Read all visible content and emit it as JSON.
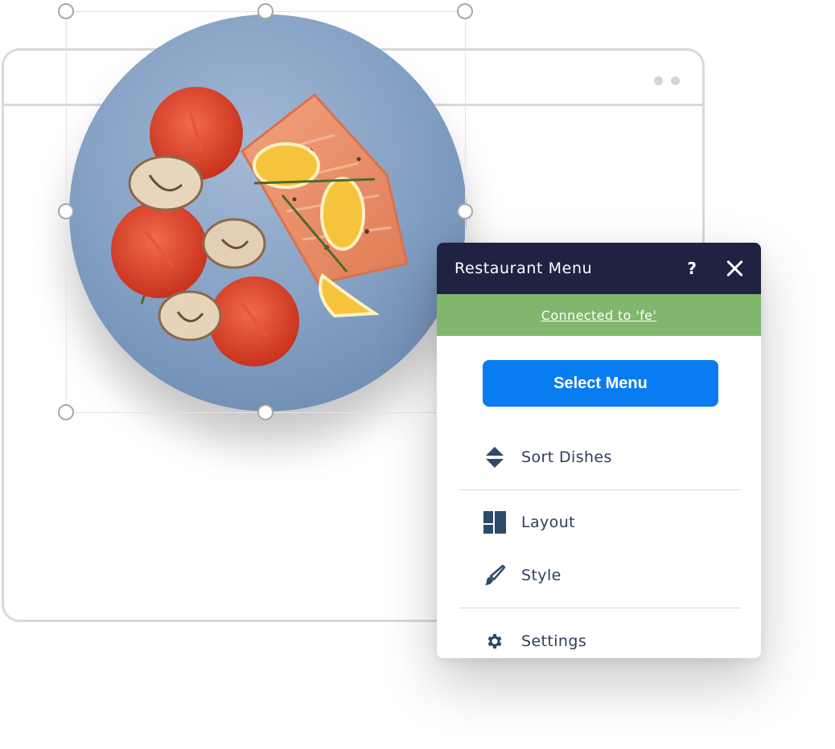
{
  "panel": {
    "title": "Restaurant Menu",
    "help_label": "?",
    "status_link": "Connected to 'fe'",
    "primary_button": "Select Menu",
    "items": [
      {
        "label": "Sort Dishes",
        "icon": "sort-icon"
      },
      {
        "label": "Layout",
        "icon": "layout-icon"
      },
      {
        "label": "Style",
        "icon": "brush-icon"
      },
      {
        "label": "Settings",
        "icon": "gear-icon"
      }
    ]
  },
  "colors": {
    "header_bg": "#1f2341",
    "status_bg": "#81b66e",
    "primary_button": "#0a7cf2",
    "item_text": "#2c3e5a",
    "plate": "#7f9cc0"
  }
}
